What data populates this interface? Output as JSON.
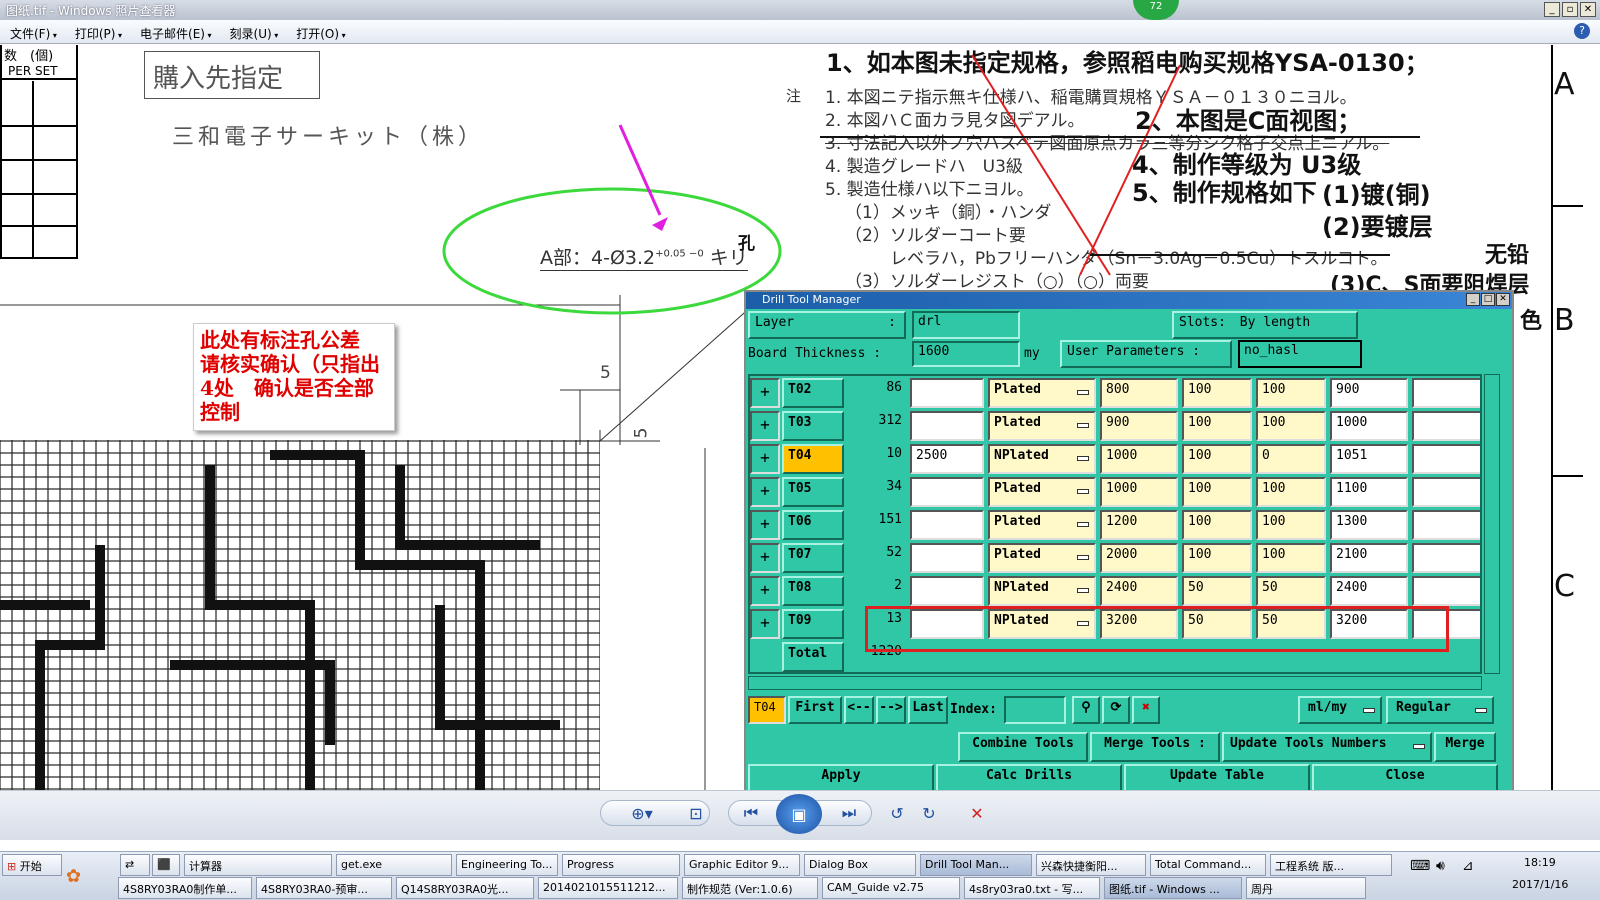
{
  "window": {
    "title": "图纸.tif - Windows 照片查看器",
    "badge": "72"
  },
  "menu": [
    "文件(F)",
    "打印(P)",
    "电子邮件(E)",
    "刻录(U)",
    "打开(O)"
  ],
  "drawing": {
    "table_header": "数　(個)",
    "table_header2": "PER SET",
    "box_title": "購入先指定",
    "company": "三和電子サーキット（株）",
    "hole_note": "A部：4-Ø3.2",
    "hole_tol": "+0.05 −0",
    "hole_suffix": "キリ",
    "hole_cn": "孔",
    "dim5a": "5",
    "dim5b": "5",
    "note_mark": "注",
    "notes_jp": [
      "1. 本図ニテ指示無キ仕様ハ、稲電購買規格ＹＳＡ－０１３０ニヨル。",
      "2. 本図ハＣ面カラ見タ図デアル。",
      "3. 寸法記入以外ノ穴ハスベテ図面原点カラ三等分シク格子交点上ニアル。",
      "4. 製造グレードハ　U3級",
      "5. 製造仕様ハ以下ニヨル。",
      "（1）メッキ（銅）・ハンダ",
      "（2）ソルダーコート要",
      "レベラハ，Pbフリーハンダ（Sn－3.0Ag－0.5Cu）トスルコト。",
      "（3）ソルダーレジスト（○）（○）両要"
    ],
    "notes_cn": {
      "n1": "1、如本图未指定规格，参照稻电购买规格YSA-0130；",
      "n2": "2、本图是C面视图；",
      "n4": "4、制作等级为 U3级",
      "n5": "5、制作规格如下",
      "s1": "(1)镀(铜)",
      "s2": "(2)要镀层",
      "lead": "无铅",
      "s3": "(3)C、S面要阻焊层",
      "color": "色"
    },
    "border_letters": [
      "A",
      "B",
      "C"
    ],
    "red_note": "此处有标注孔公差　请核实确认（只指出4处　确认是否全部控制"
  },
  "dialog": {
    "title": "Drill Tool Manager",
    "layer_label": "Layer",
    "layer_colon": ":",
    "layer_value": "drl",
    "slots_label": "Slots:",
    "slots_value": "By length",
    "board_thickness_label": "Board Thickness :",
    "board_thickness_value": "1600",
    "board_thickness_unit": "my",
    "user_params_label": "User Parameters :",
    "user_params_value": "no_hasl",
    "rows": [
      {
        "tool": "T02",
        "count": "86",
        "size": "",
        "type": "Plated",
        "c1": "800",
        "c2": "100",
        "c3": "100",
        "c4": "900",
        "selected": false
      },
      {
        "tool": "T03",
        "count": "312",
        "size": "",
        "type": "Plated",
        "c1": "900",
        "c2": "100",
        "c3": "100",
        "c4": "1000",
        "selected": false
      },
      {
        "tool": "T04",
        "count": "10",
        "size": "2500",
        "type": "NPlated",
        "c1": "1000",
        "c2": "100",
        "c3": "0",
        "c4": "1051",
        "selected": true
      },
      {
        "tool": "T05",
        "count": "34",
        "size": "",
        "type": "Plated",
        "c1": "1000",
        "c2": "100",
        "c3": "100",
        "c4": "1100",
        "selected": false
      },
      {
        "tool": "T06",
        "count": "151",
        "size": "",
        "type": "Plated",
        "c1": "1200",
        "c2": "100",
        "c3": "100",
        "c4": "1300",
        "selected": false
      },
      {
        "tool": "T07",
        "count": "52",
        "size": "",
        "type": "Plated",
        "c1": "2000",
        "c2": "100",
        "c3": "100",
        "c4": "2100",
        "selected": false
      },
      {
        "tool": "T08",
        "count": "2",
        "size": "",
        "type": "NPlated",
        "c1": "2400",
        "c2": "50",
        "c3": "50",
        "c4": "2400",
        "selected": false
      },
      {
        "tool": "T09",
        "count": "13",
        "size": "",
        "type": "NPlated",
        "c1": "3200",
        "c2": "50",
        "c3": "50",
        "c4": "3200",
        "selected": false
      }
    ],
    "total_label": "Total",
    "total_value": "1220",
    "current_tool": "T04",
    "nav": {
      "first": "First",
      "prev": "<--",
      "next": "-->",
      "last": "Last",
      "index": "Index:"
    },
    "units": "ml/my",
    "mode": "Regular",
    "combine": "Combine Tools",
    "merge_tools": "Merge Tools :",
    "update_numbers": "Update Tools Numbers",
    "merge": "Merge",
    "apply": "Apply",
    "calc": "Calc Drills",
    "update_table": "Update Table",
    "close": "Close"
  },
  "taskbar": {
    "start": "开始",
    "row1": [
      "计算器",
      "get.exe",
      "Engineering To...",
      "Progress",
      "Graphic Editor 9...",
      "Dialog Box",
      "Drill Tool Man...",
      "兴森快捷衡阳...",
      "Total Command...",
      "工程系统  版..."
    ],
    "row2": [
      "4S8RY03RA0制作单...",
      "4S8RY03RA0-预审...",
      "Q14S8RY03RA0光...",
      "2014021015511212...",
      "制作规范 (Ver:1.0.6)",
      "CAM_Guide v2.75",
      "4s8ry03ra0.txt - 写...",
      "图纸.tif - Windows ...",
      "周丹"
    ],
    "time": "18:19",
    "date": "2017/1/16"
  },
  "colors": {
    "dialog_bg": "#2fc7a5",
    "highlight": "#ffc000",
    "annotation_red": "#e00000",
    "ellipse_green": "#3cd93c",
    "arrow_magenta": "#e020e0"
  }
}
